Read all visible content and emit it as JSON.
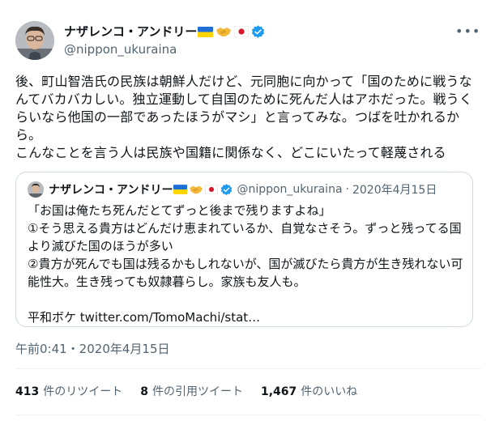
{
  "author": {
    "name": "ナザレンコ・アンドリー",
    "handle": "@nippon_ukuraina"
  },
  "tweet": {
    "text": "後、町山智浩氏の民族は朝鮮人だけど、元同胞に向かって「国のために戦うなんてバカバカしい。独立運動して自国のために死んだ人はアホだった。戦うくらいなら他国の一部であったほうがマシ」と言ってみな。つばを吐かれるから。\nこんなことを言う人は民族や国籍に関係なく、どこにいたって軽蔑される",
    "timestamp": "午前0:41・2020年4月15日"
  },
  "quote": {
    "name": "ナザレンコ・アンドリー",
    "handle": "@nippon_ukuraina",
    "separator": "·",
    "date": "2020年4月15日",
    "text": "「お国は俺たち死んだとてずっと後まで残りますよね」\n①そう思える貴方はどんだけ恵まれているか、自覚なさそう。ずっと残ってる国より滅びた国のほうが多い\n②貴方が死んでも国は残るかもしれないが、国が滅びたら貴方が生き残れない可能性大。生き残っても奴隷暮らし。家族も友人も。\n\n平和ボケ twitter.com/TomoMachi/stat…"
  },
  "stats": {
    "retweets": {
      "count": "413",
      "label": "件のリツイート"
    },
    "quotes": {
      "count": "8",
      "label": "件の引用ツイート"
    },
    "likes": {
      "count": "1,467",
      "label": "件のいいね"
    }
  },
  "more_label": "•••",
  "colors": {
    "verified": "#1d9bf0",
    "secondary_text": "#536471",
    "border": "#cfd9de"
  },
  "icons": [
    "ukraine-flag-icon",
    "handshake-icon",
    "japan-flag-icon",
    "verified-badge-icon",
    "more-options-icon"
  ]
}
